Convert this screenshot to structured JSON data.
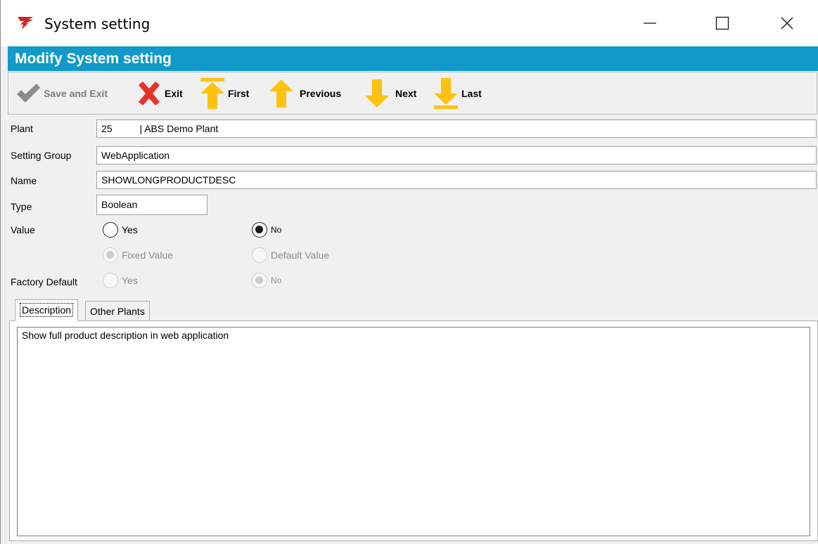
{
  "window": {
    "title": "System setting",
    "minimize_icon": "minimize-icon",
    "maximize_icon": "maximize-icon",
    "close_icon": "close-icon"
  },
  "header": {
    "title": "Modify System setting"
  },
  "toolbar": {
    "save_label": "Save and Exit",
    "exit_label": "Exit",
    "first_label": "First",
    "previous_label": "Previous",
    "next_label": "Next",
    "last_label": "Last"
  },
  "form": {
    "plant_label": "Plant",
    "plant_value": "25          | ABS Demo Plant",
    "group_label": "Setting Group",
    "group_value": "WebApplication",
    "name_label": "Name",
    "name_value": "SHOWLONGPRODUCTDESC",
    "type_label": "Type",
    "type_value": "Boolean",
    "value_label": "Value",
    "value_yes": "Yes",
    "value_no": "No",
    "value_selected": "No",
    "fixed_value": "Fixed Value",
    "default_value": "Default Value",
    "factory_label": "Factory Default",
    "factory_yes": "Yes",
    "factory_no": "No",
    "factory_selected": "No"
  },
  "tabs": [
    {
      "label": "Description",
      "active": true
    },
    {
      "label": "Other Plants",
      "active": false
    }
  ],
  "description": {
    "text": "Show full product description in web application"
  },
  "colors": {
    "header_bg": "#119ac9",
    "arrow_yellow": "#ffc20e",
    "exit_red": "#e53228",
    "check_gray": "#8c8c8c"
  }
}
